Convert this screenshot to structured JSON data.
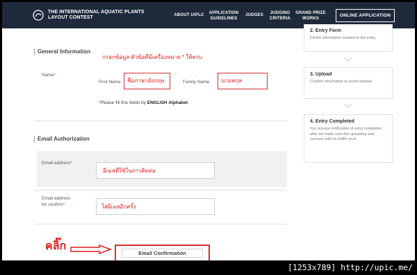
{
  "header": {
    "logo_line1": "THE INTERNATIONAL AQUATIC PLANTS",
    "logo_line2": "LAYOUT CONTEST",
    "nav": [
      {
        "line1": "ABOUT IAPLC",
        "line2": ""
      },
      {
        "line1": "APPLICATION",
        "line2": "GUIDELINES"
      },
      {
        "line1": "JUDGES",
        "line2": ""
      },
      {
        "line1": "JUDGING",
        "line2": "CRITERIA"
      },
      {
        "line1": "GRAND PRIZE",
        "line2": "WORKS"
      }
    ],
    "online_button": "ONLINE APPLICATION"
  },
  "general": {
    "title": "General Information",
    "annotation": "กรอกข้อมูล ตัวข้อที่มีเครื่องหมาย * ให้ครบ",
    "name_label": "Name",
    "required_mark": "*",
    "first_name_label": "First Name",
    "first_name_value": "ชื่อภาษาอังกฤษ",
    "family_name_label": "Family Name",
    "family_name_value": "นามสกุล",
    "helper_prefix": "*Please fill this fields by ",
    "helper_bold": "ENGLISH Alphabet",
    "helper_suffix": "."
  },
  "email": {
    "title": "Email Authorization",
    "address_label": "Email address",
    "address_value": "อีเมลที่ใช้ในการติดต่อ",
    "confirm_label_line1": "Email address",
    "confirm_label_line2": "for confirm",
    "confirm_value": "ใส่อีเมลอีกครั้ง",
    "confirm_button": "Email Confirmation",
    "click_annotation": "คลิ๊ก"
  },
  "steps": [
    {
      "title": "2. Entry Form",
      "desc": "Fill the information needed to the entry."
    },
    {
      "title": "3. Upload",
      "desc": "Confirm information to avoid mistake."
    },
    {
      "title": "4. Entry Completed",
      "desc": "You receive notification of entry completed after we make sure the uploading was success with no traffic error."
    }
  ],
  "watermark": "[1253x789] http://upic.me/",
  "colors": {
    "header_bg": "#1e2a3b",
    "annotation_red": "#e21a1a",
    "required_red": "#d9232d"
  }
}
